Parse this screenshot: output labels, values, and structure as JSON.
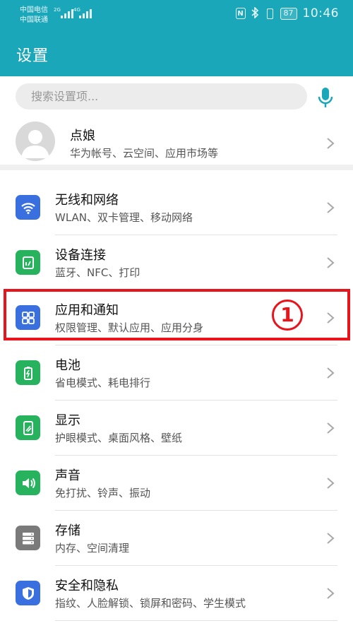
{
  "status_bar": {
    "carrier_1": "中国电信",
    "carrier_2": "中国联通",
    "net_type_1": "2G",
    "net_type_2": "4G",
    "battery": "87",
    "time": "10:46",
    "icons": [
      "nfc-icon",
      "bluetooth-icon",
      "vibrate-icon",
      "battery-icon"
    ]
  },
  "header": {
    "title": "设置",
    "background": "#1ba7ba"
  },
  "search": {
    "placeholder": "搜索设置项...",
    "accent": "#1ba7ba"
  },
  "account": {
    "name": "点娘",
    "subtitle": "华为帐号、云空间、应用市场等"
  },
  "items": [
    {
      "title": "无线和网络",
      "subtitle": "WLAN、双卡管理、移动网络",
      "icon": "wifi-icon",
      "color": "#3a6fe0"
    },
    {
      "title": "设备连接",
      "subtitle": "蓝牙、NFC、打印",
      "icon": "device-connect-icon",
      "color": "#27b35d"
    },
    {
      "title": "应用和通知",
      "subtitle": "权限管理、默认应用、应用分身",
      "icon": "apps-icon",
      "color": "#3a6fe0"
    },
    {
      "title": "电池",
      "subtitle": "省电模式、耗电排行",
      "icon": "battery-icon",
      "color": "#27b35d"
    },
    {
      "title": "显示",
      "subtitle": "护眼模式、桌面风格、壁纸",
      "icon": "display-icon",
      "color": "#27b35d"
    },
    {
      "title": "声音",
      "subtitle": "免打扰、铃声、振动",
      "icon": "sound-icon",
      "color": "#27b35d"
    },
    {
      "title": "存储",
      "subtitle": "内存、空间清理",
      "icon": "storage-icon",
      "color": "#7a7a7a"
    },
    {
      "title": "安全和隐私",
      "subtitle": "指纹、人脸解锁、锁屏和密码、学生模式",
      "icon": "security-icon",
      "color": "#3a6fe0"
    }
  ],
  "annotation": {
    "label": "①",
    "color": "#e8141c"
  }
}
